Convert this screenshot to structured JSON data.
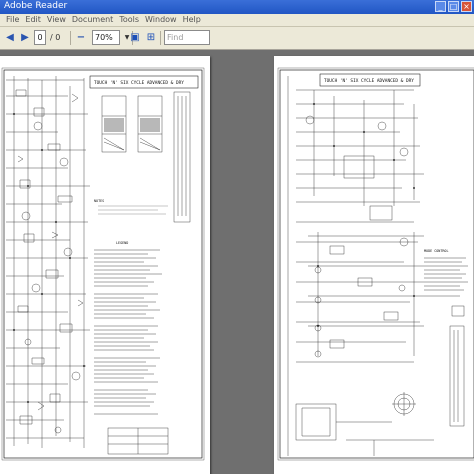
{
  "window": {
    "title": "Adobe Reader"
  },
  "menu": [
    "File",
    "Edit",
    "View",
    "Document",
    "Tools",
    "Window",
    "Help"
  ],
  "toolbar": {
    "page_current": "0",
    "page_total": "/ 0",
    "zoom": "70%",
    "find_placeholder": "Find"
  },
  "document": {
    "page1_title": "TOUCH 'N' SIX CYCLE ADVANCED & DRY",
    "page2_title": "TOUCH 'N' SIX CYCLE ADVANCED & DRY",
    "legend_heading": "LEGEND",
    "notes_heading": "NOTES",
    "mode_heading": "MODE CONTROL"
  },
  "colors": {
    "titlebar": "#2156c4",
    "chrome": "#ece9d8",
    "workspace": "#6f6f6f",
    "page": "#ffffff"
  }
}
